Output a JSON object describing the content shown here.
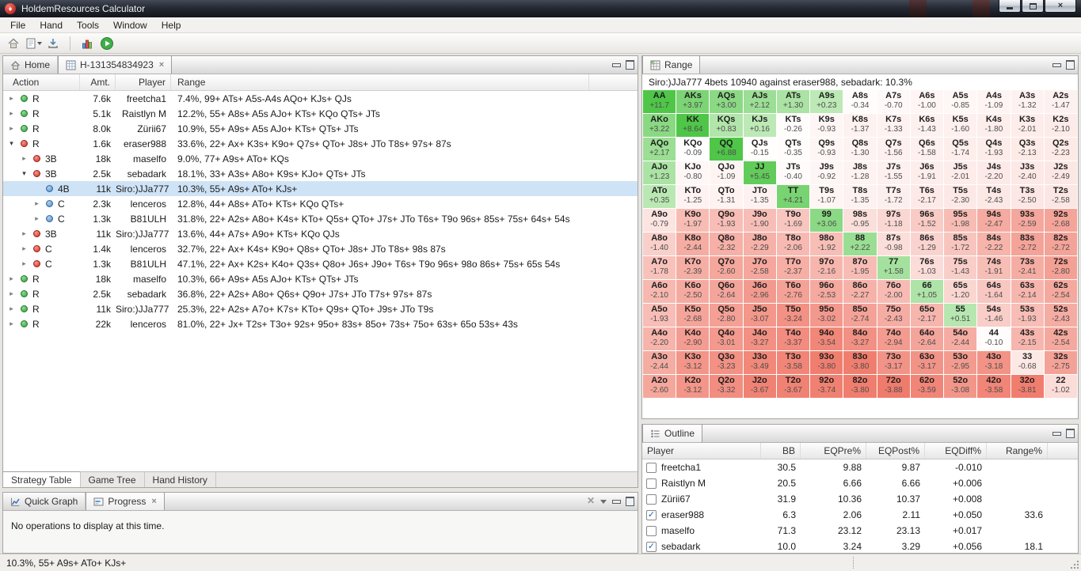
{
  "window": {
    "title": "HoldemResources Calculator"
  },
  "menu": {
    "items": [
      "File",
      "Hand",
      "Tools",
      "Window",
      "Help"
    ]
  },
  "editor": {
    "tabs": {
      "home": "Home",
      "hand": "H-131354834923"
    },
    "columns": {
      "action": "Action",
      "amt": "Amt.",
      "player": "Player",
      "range": "Range"
    },
    "rows": [
      {
        "level": 0,
        "arrow": "right",
        "dot": "green",
        "action": "R",
        "amt": "7.6k",
        "player": "freetcha1",
        "range": "7.4%, 99+ ATs+ A5s-A4s AQo+ KJs+ QJs"
      },
      {
        "level": 0,
        "arrow": "right",
        "dot": "green",
        "action": "R",
        "amt": "5.1k",
        "player": "Raistlyn M",
        "range": "12.2%, 55+ A8s+ A5s AJo+ KTs+ KQo QTs+ JTs"
      },
      {
        "level": 0,
        "arrow": "right",
        "dot": "green",
        "action": "R",
        "amt": "8.0k",
        "player": "Zürii67",
        "range": "10.9%, 55+ A9s+ A5s AJo+ KTs+ QTs+ JTs"
      },
      {
        "level": 0,
        "arrow": "down",
        "dot": "red",
        "action": "R",
        "amt": "1.6k",
        "player": "eraser988",
        "range": "33.6%, 22+ Ax+ K3s+ K9o+ Q7s+ QTo+ J8s+ JTo T8s+ 97s+ 87s"
      },
      {
        "level": 1,
        "arrow": "right",
        "dot": "red",
        "action": "3B",
        "amt": "18k",
        "player": "maselfo",
        "range": "9.0%, 77+ A9s+ ATo+ KQs"
      },
      {
        "level": 1,
        "arrow": "down",
        "dot": "red",
        "action": "3B",
        "amt": "2.5k",
        "player": "sebadark",
        "range": "18.1%, 33+ A3s+ A8o+ K9s+ KJo+ QTs+ JTs"
      },
      {
        "level": 2,
        "arrow": "none",
        "dot": "blue",
        "action": "4B",
        "amt": "11k",
        "player": "Siro:)JJa777",
        "range": "10.3%, 55+ A9s+ ATo+ KJs+",
        "selected": true
      },
      {
        "level": 2,
        "arrow": "right",
        "dot": "blue",
        "action": "C",
        "amt": "2.3k",
        "player": "lenceros",
        "range": "12.8%, 44+ A8s+ ATo+ KTs+ KQo QTs+"
      },
      {
        "level": 2,
        "arrow": "right",
        "dot": "blue",
        "action": "C",
        "amt": "1.3k",
        "player": "B81ULH",
        "range": "31.8%, 22+ A2s+ A8o+ K4s+ KTo+ Q5s+ QTo+ J7s+ JTo T6s+ T9o 96s+ 85s+ 75s+ 64s+ 54s"
      },
      {
        "level": 1,
        "arrow": "right",
        "dot": "red",
        "action": "3B",
        "amt": "11k",
        "player": "Siro:)JJa777",
        "range": "13.6%, 44+ A7s+ A9o+ KTs+ KQo QJs"
      },
      {
        "level": 1,
        "arrow": "right",
        "dot": "red",
        "action": "C",
        "amt": "1.4k",
        "player": "lenceros",
        "range": "32.7%, 22+ Ax+ K4s+ K9o+ Q8s+ QTo+ J8s+ JTo T8s+ 98s 87s"
      },
      {
        "level": 1,
        "arrow": "right",
        "dot": "red",
        "action": "C",
        "amt": "1.3k",
        "player": "B81ULH",
        "range": "47.1%, 22+ Ax+ K2s+ K4o+ Q3s+ Q8o+ J6s+ J9o+ T6s+ T9o 96s+ 98o 86s+ 75s+ 65s 54s"
      },
      {
        "level": 0,
        "arrow": "right",
        "dot": "green",
        "action": "R",
        "amt": "18k",
        "player": "maselfo",
        "range": "10.3%, 66+ A9s+ A5s AJo+ KTs+ QTs+ JTs"
      },
      {
        "level": 0,
        "arrow": "right",
        "dot": "green",
        "action": "R",
        "amt": "2.5k",
        "player": "sebadark",
        "range": "36.8%, 22+ A2s+ A8o+ Q6s+ Q9o+ J7s+ JTo T7s+ 97s+ 87s"
      },
      {
        "level": 0,
        "arrow": "right",
        "dot": "green",
        "action": "R",
        "amt": "11k",
        "player": "Siro:)JJa777",
        "range": "25.3%, 22+ A2s+ A7o+ K7s+ KTo+ Q9s+ QTo+ J9s+ JTo T9s"
      },
      {
        "level": 0,
        "arrow": "right",
        "dot": "green",
        "action": "R",
        "amt": "22k",
        "player": "lenceros",
        "range": "81.0%, 22+ Jx+ T2s+ T3o+ 92s+ 95o+ 83s+ 85o+ 73s+ 75o+ 63s+ 65o 53s+ 43s"
      }
    ],
    "bottom_tabs": [
      "Strategy Table",
      "Game Tree",
      "Hand History"
    ]
  },
  "range_view": {
    "tab_label": "Range",
    "header": "Siro:)JJa777 4bets 10940 against eraser988, sebadark: 10.3%",
    "grid": [
      [
        [
          "AA",
          "+11.7"
        ],
        [
          "AKs",
          "+3.97"
        ],
        [
          "AQs",
          "+3.00"
        ],
        [
          "AJs",
          "+2.12"
        ],
        [
          "ATs",
          "+1.30"
        ],
        [
          "A9s",
          "+0.23"
        ],
        [
          "A8s",
          "-0.34"
        ],
        [
          "A7s",
          "-0.70"
        ],
        [
          "A6s",
          "-1.00"
        ],
        [
          "A5s",
          "-0.85"
        ],
        [
          "A4s",
          "-1.09"
        ],
        [
          "A3s",
          "-1.32"
        ],
        [
          "A2s",
          "-1.47"
        ]
      ],
      [
        [
          "AKo",
          "+3.22"
        ],
        [
          "KK",
          "+8.64"
        ],
        [
          "KQs",
          "+0.83"
        ],
        [
          "KJs",
          "+0.16"
        ],
        [
          "KTs",
          "-0.26"
        ],
        [
          "K9s",
          "-0.93"
        ],
        [
          "K8s",
          "-1.37"
        ],
        [
          "K7s",
          "-1.33"
        ],
        [
          "K6s",
          "-1.43"
        ],
        [
          "K5s",
          "-1.60"
        ],
        [
          "K4s",
          "-1.80"
        ],
        [
          "K3s",
          "-2.01"
        ],
        [
          "K2s",
          "-2.10"
        ]
      ],
      [
        [
          "AQo",
          "+2.17"
        ],
        [
          "KQo",
          "-0.09"
        ],
        [
          "QQ",
          "+6.88"
        ],
        [
          "QJs",
          "-0.15"
        ],
        [
          "QTs",
          "-0.35"
        ],
        [
          "Q9s",
          "-0.93"
        ],
        [
          "Q8s",
          "-1.30"
        ],
        [
          "Q7s",
          "-1.56"
        ],
        [
          "Q6s",
          "-1.58"
        ],
        [
          "Q5s",
          "-1.74"
        ],
        [
          "Q4s",
          "-1.93"
        ],
        [
          "Q3s",
          "-2.13"
        ],
        [
          "Q2s",
          "-2.23"
        ]
      ],
      [
        [
          "AJo",
          "+1.23"
        ],
        [
          "KJo",
          "-0.80"
        ],
        [
          "QJo",
          "-1.09"
        ],
        [
          "JJ",
          "+5.45"
        ],
        [
          "JTs",
          "-0.40"
        ],
        [
          "J9s",
          "-0.92"
        ],
        [
          "J8s",
          "-1.28"
        ],
        [
          "J7s",
          "-1.55"
        ],
        [
          "J6s",
          "-1.91"
        ],
        [
          "J5s",
          "-2.01"
        ],
        [
          "J4s",
          "-2.20"
        ],
        [
          "J3s",
          "-2.40"
        ],
        [
          "J2s",
          "-2.49"
        ]
      ],
      [
        [
          "ATo",
          "+0.35"
        ],
        [
          "KTo",
          "-1.25"
        ],
        [
          "QTo",
          "-1.31"
        ],
        [
          "JTo",
          "-1.35"
        ],
        [
          "TT",
          "+4.21"
        ],
        [
          "T9s",
          "-1.07"
        ],
        [
          "T8s",
          "-1.35"
        ],
        [
          "T7s",
          "-1.72"
        ],
        [
          "T6s",
          "-2.17"
        ],
        [
          "T5s",
          "-2.30"
        ],
        [
          "T4s",
          "-2.43"
        ],
        [
          "T3s",
          "-2.50"
        ],
        [
          "T2s",
          "-2.58"
        ]
      ],
      [
        [
          "A9o",
          "-0.79"
        ],
        [
          "K9o",
          "-1.97"
        ],
        [
          "Q9o",
          "-1.93"
        ],
        [
          "J9o",
          "-1.90"
        ],
        [
          "T9o",
          "-1.69"
        ],
        [
          "99",
          "+3.06"
        ],
        [
          "98s",
          "-0.95"
        ],
        [
          "97s",
          "-1.18"
        ],
        [
          "96s",
          "-1.52"
        ],
        [
          "95s",
          "-1.98"
        ],
        [
          "94s",
          "-2.47"
        ],
        [
          "93s",
          "-2.59"
        ],
        [
          "92s",
          "-2.68"
        ]
      ],
      [
        [
          "A8o",
          "-1.40"
        ],
        [
          "K8o",
          "-2.44"
        ],
        [
          "Q8o",
          "-2.32"
        ],
        [
          "J8o",
          "-2.29"
        ],
        [
          "T8o",
          "-2.06"
        ],
        [
          "98o",
          "-1.92"
        ],
        [
          "88",
          "+2.22"
        ],
        [
          "87s",
          "-0.98"
        ],
        [
          "86s",
          "-1.29"
        ],
        [
          "85s",
          "-1.72"
        ],
        [
          "84s",
          "-2.22"
        ],
        [
          "83s",
          "-2.72"
        ],
        [
          "82s",
          "-2.72"
        ]
      ],
      [
        [
          "A7o",
          "-1.78"
        ],
        [
          "K7o",
          "-2.39"
        ],
        [
          "Q7o",
          "-2.60"
        ],
        [
          "J7o",
          "-2.58"
        ],
        [
          "T7o",
          "-2.37"
        ],
        [
          "97o",
          "-2.16"
        ],
        [
          "87o",
          "-1.95"
        ],
        [
          "77",
          "+1.58"
        ],
        [
          "76s",
          "-1.03"
        ],
        [
          "75s",
          "-1.43"
        ],
        [
          "74s",
          "-1.91"
        ],
        [
          "73s",
          "-2.41"
        ],
        [
          "72s",
          "-2.80"
        ]
      ],
      [
        [
          "A6o",
          "-2.10"
        ],
        [
          "K6o",
          "-2.50"
        ],
        [
          "Q6o",
          "-2.64"
        ],
        [
          "J6o",
          "-2.96"
        ],
        [
          "T6o",
          "-2.76"
        ],
        [
          "96o",
          "-2.53"
        ],
        [
          "86o",
          "-2.27"
        ],
        [
          "76o",
          "-2.00"
        ],
        [
          "66",
          "+1.05"
        ],
        [
          "65s",
          "-1.20"
        ],
        [
          "64s",
          "-1.64"
        ],
        [
          "63s",
          "-2.14"
        ],
        [
          "62s",
          "-2.54"
        ]
      ],
      [
        [
          "A5o",
          "-1.93"
        ],
        [
          "K5o",
          "-2.68"
        ],
        [
          "Q5o",
          "-2.80"
        ],
        [
          "J5o",
          "-3.07"
        ],
        [
          "T5o",
          "-3.24"
        ],
        [
          "95o",
          "-3.02"
        ],
        [
          "85o",
          "-2.74"
        ],
        [
          "75o",
          "-2.43"
        ],
        [
          "65o",
          "-2.17"
        ],
        [
          "55",
          "+0.51"
        ],
        [
          "54s",
          "-1.46"
        ],
        [
          "53s",
          "-1.93"
        ],
        [
          "52s",
          "-2.43"
        ]
      ],
      [
        [
          "A4o",
          "-2.20"
        ],
        [
          "K4o",
          "-2.90"
        ],
        [
          "Q4o",
          "-3.01"
        ],
        [
          "J4o",
          "-3.27"
        ],
        [
          "T4o",
          "-3.37"
        ],
        [
          "94o",
          "-3.54"
        ],
        [
          "84o",
          "-3.27"
        ],
        [
          "74o",
          "-2.94"
        ],
        [
          "64o",
          "-2.64"
        ],
        [
          "54o",
          "-2.44"
        ],
        [
          "44",
          "-0.10"
        ],
        [
          "43s",
          "-2.15"
        ],
        [
          "42s",
          "-2.54"
        ]
      ],
      [
        [
          "A3o",
          "-2.44"
        ],
        [
          "K3o",
          "-3.12"
        ],
        [
          "Q3o",
          "-3.23"
        ],
        [
          "J3o",
          "-3.49"
        ],
        [
          "T3o",
          "-3.58"
        ],
        [
          "93o",
          "-3.80"
        ],
        [
          "83o",
          "-3.80"
        ],
        [
          "73o",
          "-3.17"
        ],
        [
          "63o",
          "-3.17"
        ],
        [
          "53o",
          "-2.95"
        ],
        [
          "43o",
          "-3.18"
        ],
        [
          "33",
          "-0.68"
        ],
        [
          "32s",
          "-2.75"
        ]
      ],
      [
        [
          "A2o",
          "-2.60"
        ],
        [
          "K2o",
          "-3.12"
        ],
        [
          "Q2o",
          "-3.32"
        ],
        [
          "J2o",
          "-3.67"
        ],
        [
          "T2o",
          "-3.67"
        ],
        [
          "92o",
          "-3.74"
        ],
        [
          "82o",
          "-3.80"
        ],
        [
          "72o",
          "-3.88"
        ],
        [
          "62o",
          "-3.59"
        ],
        [
          "52o",
          "-3.08"
        ],
        [
          "42o",
          "-3.58"
        ],
        [
          "32o",
          "-3.81"
        ],
        [
          "22",
          "-1.02"
        ]
      ]
    ]
  },
  "outline_view": {
    "tab_label": "Outline",
    "columns": [
      "Player",
      "BB",
      "EQPre%",
      "EQPost%",
      "EQDiff%",
      "Range%"
    ],
    "rows": [
      {
        "checked": false,
        "player": "freetcha1",
        "bb": "30.5",
        "eqpre": "9.88",
        "eqpost": "9.87",
        "eqdiff": "-0.010",
        "range": ""
      },
      {
        "checked": false,
        "player": "Raistlyn M",
        "bb": "20.5",
        "eqpre": "6.66",
        "eqpost": "6.66",
        "eqdiff": "+0.006",
        "range": ""
      },
      {
        "checked": false,
        "player": "Zürii67",
        "bb": "31.9",
        "eqpre": "10.36",
        "eqpost": "10.37",
        "eqdiff": "+0.008",
        "range": ""
      },
      {
        "checked": true,
        "player": "eraser988",
        "bb": "6.3",
        "eqpre": "2.06",
        "eqpost": "2.11",
        "eqdiff": "+0.050",
        "range": "33.6"
      },
      {
        "checked": false,
        "player": "maselfo",
        "bb": "71.3",
        "eqpre": "23.12",
        "eqpost": "23.13",
        "eqdiff": "+0.017",
        "range": ""
      },
      {
        "checked": true,
        "player": "sebadark",
        "bb": "10.0",
        "eqpre": "3.24",
        "eqpost": "3.29",
        "eqdiff": "+0.056",
        "range": "18.1"
      }
    ]
  },
  "progress_view": {
    "tabs": {
      "quick_graph": "Quick Graph",
      "progress": "Progress"
    },
    "message": "No operations to display at this time."
  },
  "status_bar": {
    "text": "10.3%, 55+ A9s+ ATo+ KJs+"
  },
  "colors": {
    "in_range_green": "#4fc648",
    "out_of_range_red": "#ef7767",
    "selection_blue": "#cfe3f6"
  }
}
